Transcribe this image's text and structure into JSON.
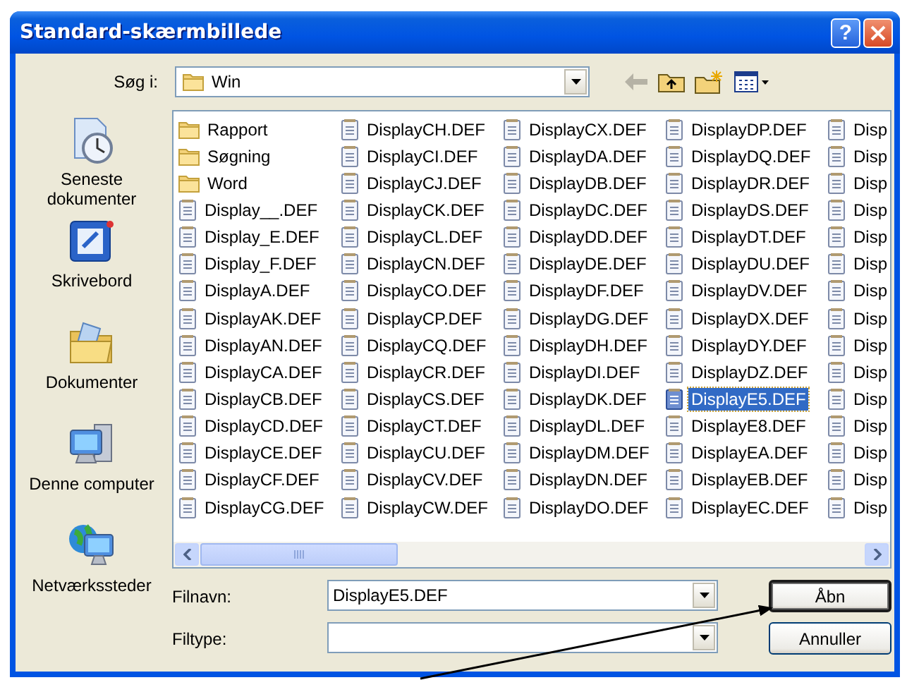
{
  "window": {
    "title": "Standard-skærmbillede",
    "help_button": "?"
  },
  "look_in": {
    "label": "Søg i:",
    "value": "Win"
  },
  "places": [
    {
      "kind": "recent",
      "label": "Seneste dokumenter"
    },
    {
      "kind": "desktop",
      "label": "Skrivebord"
    },
    {
      "kind": "documents",
      "label": "Dokumenter"
    },
    {
      "kind": "computer",
      "label": "Denne computer"
    },
    {
      "kind": "network",
      "label": "Netværkssteder"
    }
  ],
  "files": [
    {
      "kind": "folder",
      "name": "Rapport",
      "selected": false
    },
    {
      "kind": "folder",
      "name": "Søgning",
      "selected": false
    },
    {
      "kind": "folder",
      "name": "Word",
      "selected": false
    },
    {
      "kind": "file",
      "name": "Display__.DEF",
      "selected": false
    },
    {
      "kind": "file",
      "name": "Display_E.DEF",
      "selected": false
    },
    {
      "kind": "file",
      "name": "Display_F.DEF",
      "selected": false
    },
    {
      "kind": "file",
      "name": "DisplayA.DEF",
      "selected": false
    },
    {
      "kind": "file",
      "name": "DisplayAK.DEF",
      "selected": false
    },
    {
      "kind": "file",
      "name": "DisplayAN.DEF",
      "selected": false
    },
    {
      "kind": "file",
      "name": "DisplayCA.DEF",
      "selected": false
    },
    {
      "kind": "file",
      "name": "DisplayCB.DEF",
      "selected": false
    },
    {
      "kind": "file",
      "name": "DisplayCD.DEF",
      "selected": false
    },
    {
      "kind": "file",
      "name": "DisplayCE.DEF",
      "selected": false
    },
    {
      "kind": "file",
      "name": "DisplayCF.DEF",
      "selected": false
    },
    {
      "kind": "file",
      "name": "DisplayCG.DEF",
      "selected": false
    },
    {
      "kind": "file",
      "name": "DisplayCH.DEF",
      "selected": false
    },
    {
      "kind": "file",
      "name": "DisplayCI.DEF",
      "selected": false
    },
    {
      "kind": "file",
      "name": "DisplayCJ.DEF",
      "selected": false
    },
    {
      "kind": "file",
      "name": "DisplayCK.DEF",
      "selected": false
    },
    {
      "kind": "file",
      "name": "DisplayCL.DEF",
      "selected": false
    },
    {
      "kind": "file",
      "name": "DisplayCN.DEF",
      "selected": false
    },
    {
      "kind": "file",
      "name": "DisplayCO.DEF",
      "selected": false
    },
    {
      "kind": "file",
      "name": "DisplayCP.DEF",
      "selected": false
    },
    {
      "kind": "file",
      "name": "DisplayCQ.DEF",
      "selected": false
    },
    {
      "kind": "file",
      "name": "DisplayCR.DEF",
      "selected": false
    },
    {
      "kind": "file",
      "name": "DisplayCS.DEF",
      "selected": false
    },
    {
      "kind": "file",
      "name": "DisplayCT.DEF",
      "selected": false
    },
    {
      "kind": "file",
      "name": "DisplayCU.DEF",
      "selected": false
    },
    {
      "kind": "file",
      "name": "DisplayCV.DEF",
      "selected": false
    },
    {
      "kind": "file",
      "name": "DisplayCW.DEF",
      "selected": false
    },
    {
      "kind": "file",
      "name": "DisplayCX.DEF",
      "selected": false
    },
    {
      "kind": "file",
      "name": "DisplayDA.DEF",
      "selected": false
    },
    {
      "kind": "file",
      "name": "DisplayDB.DEF",
      "selected": false
    },
    {
      "kind": "file",
      "name": "DisplayDC.DEF",
      "selected": false
    },
    {
      "kind": "file",
      "name": "DisplayDD.DEF",
      "selected": false
    },
    {
      "kind": "file",
      "name": "DisplayDE.DEF",
      "selected": false
    },
    {
      "kind": "file",
      "name": "DisplayDF.DEF",
      "selected": false
    },
    {
      "kind": "file",
      "name": "DisplayDG.DEF",
      "selected": false
    },
    {
      "kind": "file",
      "name": "DisplayDH.DEF",
      "selected": false
    },
    {
      "kind": "file",
      "name": "DisplayDI.DEF",
      "selected": false
    },
    {
      "kind": "file",
      "name": "DisplayDK.DEF",
      "selected": false
    },
    {
      "kind": "file",
      "name": "DisplayDL.DEF",
      "selected": false
    },
    {
      "kind": "file",
      "name": "DisplayDM.DEF",
      "selected": false
    },
    {
      "kind": "file",
      "name": "DisplayDN.DEF",
      "selected": false
    },
    {
      "kind": "file",
      "name": "DisplayDO.DEF",
      "selected": false
    },
    {
      "kind": "file",
      "name": "DisplayDP.DEF",
      "selected": false
    },
    {
      "kind": "file",
      "name": "DisplayDQ.DEF",
      "selected": false
    },
    {
      "kind": "file",
      "name": "DisplayDR.DEF",
      "selected": false
    },
    {
      "kind": "file",
      "name": "DisplayDS.DEF",
      "selected": false
    },
    {
      "kind": "file",
      "name": "DisplayDT.DEF",
      "selected": false
    },
    {
      "kind": "file",
      "name": "DisplayDU.DEF",
      "selected": false
    },
    {
      "kind": "file",
      "name": "DisplayDV.DEF",
      "selected": false
    },
    {
      "kind": "file",
      "name": "DisplayDX.DEF",
      "selected": false
    },
    {
      "kind": "file",
      "name": "DisplayDY.DEF",
      "selected": false
    },
    {
      "kind": "file",
      "name": "DisplayDZ.DEF",
      "selected": false
    },
    {
      "kind": "file",
      "name": "DisplayE5.DEF",
      "selected": true
    },
    {
      "kind": "file",
      "name": "DisplayE8.DEF",
      "selected": false
    },
    {
      "kind": "file",
      "name": "DisplayEA.DEF",
      "selected": false
    },
    {
      "kind": "file",
      "name": "DisplayEB.DEF",
      "selected": false
    },
    {
      "kind": "file",
      "name": "DisplayEC.DEF",
      "selected": false
    },
    {
      "kind": "file",
      "name": "Disp",
      "selected": false
    },
    {
      "kind": "file",
      "name": "Disp",
      "selected": false
    },
    {
      "kind": "file",
      "name": "Disp",
      "selected": false
    },
    {
      "kind": "file",
      "name": "Disp",
      "selected": false
    },
    {
      "kind": "file",
      "name": "Disp",
      "selected": false
    },
    {
      "kind": "file",
      "name": "Disp",
      "selected": false
    },
    {
      "kind": "file",
      "name": "Disp",
      "selected": false
    },
    {
      "kind": "file",
      "name": "Disp",
      "selected": false
    },
    {
      "kind": "file",
      "name": "Disp",
      "selected": false
    },
    {
      "kind": "file",
      "name": "Disp",
      "selected": false
    },
    {
      "kind": "file",
      "name": "Disp",
      "selected": false
    },
    {
      "kind": "file",
      "name": "Disp",
      "selected": false
    },
    {
      "kind": "file",
      "name": "Disp",
      "selected": false
    },
    {
      "kind": "file",
      "name": "Disp",
      "selected": false
    },
    {
      "kind": "file",
      "name": "Disp",
      "selected": false
    }
  ],
  "file_name": {
    "label": "Filnavn:",
    "value": "DisplayE5.DEF"
  },
  "file_type": {
    "label": "Filtype:"
  },
  "buttons": [
    {
      "label": "Åbn",
      "default": true
    },
    {
      "label": "Annuller",
      "default": false
    }
  ]
}
